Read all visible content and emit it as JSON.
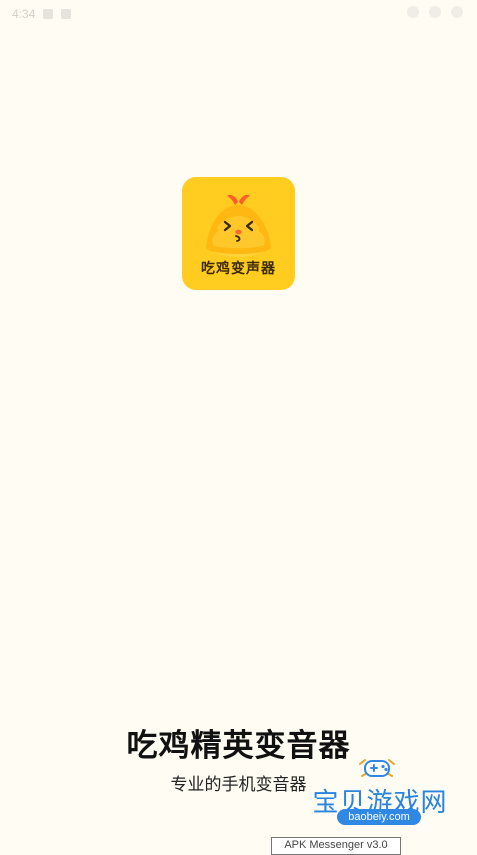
{
  "status_bar": {
    "time": "4:34"
  },
  "app": {
    "icon_label": "吃鸡变声器",
    "title": "吃鸡精英变音器",
    "subtitle": "专业的手机变音器"
  },
  "watermark": {
    "site": "宝贝游戏网",
    "url": "baobeiy.com"
  },
  "overlay": {
    "tag": "APK Messenger v3.0"
  },
  "colors": {
    "background": "#fffcf3",
    "icon_bg": "#ffcc1f",
    "watermark_blue": "#2f89e3"
  }
}
